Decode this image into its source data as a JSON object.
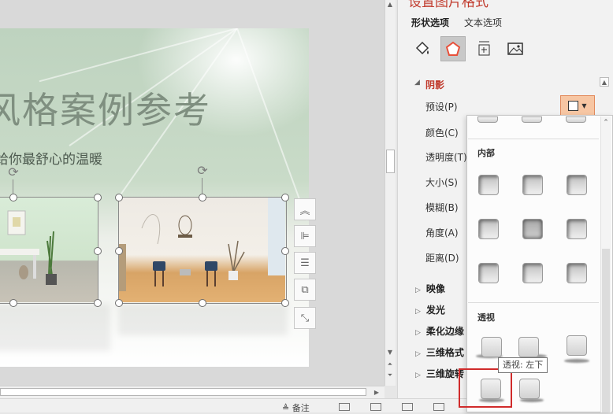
{
  "pane": {
    "title": "设置图片格式",
    "tabs": [
      {
        "label": "形状选项",
        "active": true
      },
      {
        "label": "文本选项",
        "active": false
      }
    ],
    "icons": [
      "fill-line-icon",
      "effects-icon",
      "size-properties-icon",
      "picture-icon"
    ],
    "active_icon": "effects-icon"
  },
  "shadow_section": {
    "title": "阴影",
    "expanded": true,
    "properties": [
      {
        "label": "预设(P)"
      },
      {
        "label": "颜色(C)"
      },
      {
        "label": "透明度(T)"
      },
      {
        "label": "大小(S)"
      },
      {
        "label": "模糊(B)"
      },
      {
        "label": "角度(A)"
      },
      {
        "label": "距离(D)"
      }
    ]
  },
  "collapsed_sections": [
    "映像",
    "发光",
    "柔化边缘",
    "三维格式",
    "三维旋转"
  ],
  "gallery": {
    "inner_header": "内部",
    "perspective_header": "透视",
    "tooltip": "透视: 左下",
    "highlighted": "透视: 左下"
  },
  "slide": {
    "title": "风格案例参考",
    "subtitle": "给你最舒心的温暖"
  },
  "statusbar": {
    "notes_label": "≜ 备注"
  },
  "colors": {
    "pane_accent": "#c0392b",
    "preset_button_bg": "#f7c6a3",
    "highlight_frame": "#d02b2b",
    "slide_green": "#bed3bf"
  }
}
